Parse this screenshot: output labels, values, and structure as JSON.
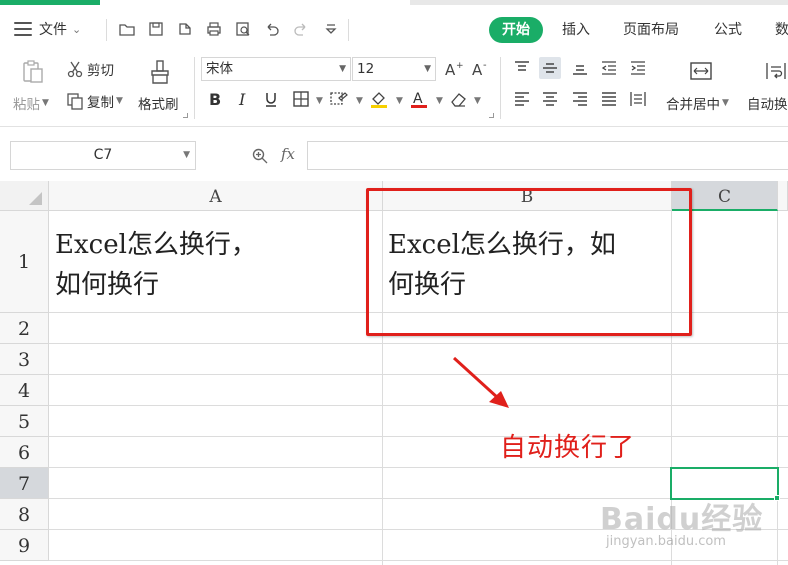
{
  "menubar": {
    "file_label": "文件",
    "tabs": [
      {
        "label": "开始",
        "active": true
      },
      {
        "label": "插入",
        "active": false
      },
      {
        "label": "页面布局",
        "active": false
      },
      {
        "label": "公式",
        "active": false
      },
      {
        "label": "数",
        "active": false
      }
    ]
  },
  "ribbon": {
    "paste_label": "粘贴",
    "cut_label": "剪切",
    "copy_label": "复制",
    "format_painter_label": "格式刷",
    "font_name": "宋体",
    "font_size": "12",
    "merge_label": "合并居中",
    "wrap_label": "自动换"
  },
  "formula_bar": {
    "name_box": "C7",
    "fx_label": "fx",
    "formula": ""
  },
  "sheet": {
    "columns": [
      "A",
      "B",
      "C"
    ],
    "rows": [
      "1",
      "2",
      "3",
      "4",
      "5",
      "6",
      "7",
      "8",
      "9"
    ],
    "active_column": "C",
    "active_row": "7",
    "cells": {
      "A1": "Excel怎么换行，\n如何换行",
      "B1": "Excel怎么换行，如\n何换行"
    }
  },
  "annotation": {
    "text": "自动换行了",
    "color": "#e0201b"
  },
  "watermark": {
    "logo": "Baidu经验",
    "url": "jingyan.baidu.com"
  },
  "colors": {
    "accent": "#1aad67",
    "highlight": "#e0201b"
  }
}
